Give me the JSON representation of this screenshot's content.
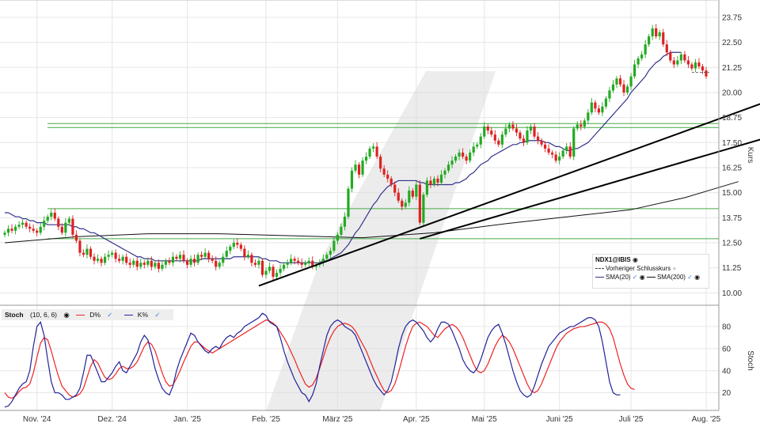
{
  "chart_data": [
    {
      "type": "candlestick",
      "symbol": "NDX1@IBIS",
      "ylabel": "Kurs",
      "ylim": [
        9.5,
        24.3
      ],
      "y_ticks": [
        "10.00",
        "11.25",
        "12.50",
        "13.75",
        "15.00",
        "16.25",
        "17.50",
        "18.75",
        "20.00",
        "21.25",
        "22.50",
        "23.75"
      ],
      "x_ticks": [
        "Nov. '24",
        "Dez. '24",
        "Jan. '25",
        "Feb. '25",
        "März '25",
        "Apr. '25",
        "Mai '25",
        "Juni '25",
        "Juli '25",
        "Aug. '25"
      ],
      "x_tick_pos": [
        9,
        30,
        51,
        73,
        93,
        115,
        134,
        155,
        175,
        196
      ],
      "close": [
        13.0,
        13.2,
        13.1,
        13.3,
        13.4,
        13.5,
        13.3,
        13.2,
        13.1,
        13.0,
        13.3,
        13.6,
        13.8,
        14.0,
        13.7,
        13.3,
        13.0,
        13.5,
        13.7,
        12.9,
        12.6,
        12.0,
        11.9,
        12.2,
        11.8,
        11.6,
        11.7,
        11.5,
        11.8,
        11.9,
        12.0,
        11.7,
        11.6,
        11.8,
        11.5,
        11.4,
        11.6,
        11.3,
        11.5,
        11.4,
        11.6,
        11.3,
        11.5,
        11.2,
        11.4,
        11.6,
        11.5,
        11.8,
        11.7,
        11.9,
        11.6,
        11.4,
        11.7,
        11.5,
        11.9,
        11.8,
        12.0,
        11.7,
        11.6,
        11.3,
        11.5,
        11.8,
        12.1,
        12.3,
        12.5,
        12.4,
        12.2,
        11.8,
        11.9,
        11.5,
        11.4,
        11.6,
        10.9,
        11.1,
        11.3,
        10.8,
        11.0,
        11.2,
        11.4,
        11.5,
        11.7,
        11.6,
        11.5,
        11.4,
        11.5,
        11.6,
        11.3,
        11.4,
        11.5,
        11.7,
        11.9,
        12.1,
        12.6,
        12.9,
        13.3,
        13.8,
        15.2,
        16.1,
        16.4,
        15.9,
        16.6,
        16.8,
        17.2,
        17.3,
        16.8,
        16.2,
        15.9,
        15.7,
        15.4,
        15.0,
        14.6,
        14.3,
        14.5,
        15.1,
        14.8,
        15.4,
        13.5,
        14.9,
        15.6,
        15.4,
        15.7,
        15.5,
        15.9,
        16.1,
        16.4,
        16.6,
        16.8,
        17.0,
        16.8,
        16.6,
        17.0,
        17.3,
        17.4,
        17.8,
        18.3,
        18.1,
        17.9,
        17.6,
        17.4,
        17.9,
        18.2,
        18.4,
        18.2,
        18.0,
        17.7,
        17.5,
        18.1,
        18.3,
        17.8,
        17.6,
        17.4,
        17.2,
        17.0,
        16.9,
        16.6,
        16.8,
        17.1,
        17.3,
        16.8,
        18.2,
        18.4,
        18.3,
        18.6,
        19.0,
        19.5,
        19.2,
        19.0,
        19.3,
        19.7,
        20.1,
        20.4,
        20.7,
        20.4,
        20.0,
        20.3,
        20.8,
        21.4,
        21.7,
        21.9,
        22.4,
        22.8,
        23.2,
        22.8,
        23.0,
        22.4,
        22.0,
        21.6,
        21.4,
        21.6,
        21.9,
        21.6,
        21.4,
        21.2,
        21.5,
        21.3,
        21.1,
        20.8
      ],
      "sma20": [
        14.0,
        14.0,
        13.9,
        13.8,
        13.8,
        13.7,
        13.7,
        13.6,
        13.6,
        13.5,
        13.5,
        13.5,
        13.4,
        13.4,
        13.4,
        13.4,
        13.4,
        13.4,
        13.4,
        13.3,
        13.3,
        13.2,
        13.2,
        13.1,
        13.0,
        13.0,
        12.9,
        12.8,
        12.7,
        12.6,
        12.5,
        12.4,
        12.3,
        12.2,
        12.1,
        12.0,
        11.9,
        11.8,
        11.8,
        11.7,
        11.7,
        11.7,
        11.6,
        11.6,
        11.6,
        11.6,
        11.6,
        11.6,
        11.6,
        11.6,
        11.6,
        11.6,
        11.6,
        11.6,
        11.6,
        11.7,
        11.7,
        11.7,
        11.7,
        11.7,
        11.7,
        11.7,
        11.7,
        11.7,
        11.8,
        11.8,
        11.8,
        11.8,
        11.8,
        11.8,
        11.8,
        11.8,
        11.7,
        11.7,
        11.6,
        11.6,
        11.6,
        11.5,
        11.5,
        11.5,
        11.5,
        11.5,
        11.5,
        11.5,
        11.5,
        11.5,
        11.5,
        11.5,
        11.5,
        11.6,
        11.6,
        11.7,
        11.8,
        11.9,
        12.0,
        12.2,
        12.4,
        12.7,
        13.0,
        13.2,
        13.5,
        13.8,
        14.1,
        14.4,
        14.6,
        14.9,
        15.1,
        15.3,
        15.4,
        15.5,
        15.6,
        15.6,
        15.6,
        15.6,
        15.6,
        15.6,
        15.5,
        15.5,
        15.4,
        15.4,
        15.4,
        15.4,
        15.4,
        15.4,
        15.4,
        15.4,
        15.5,
        15.5,
        15.6,
        15.7,
        15.9,
        16.0,
        16.2,
        16.4,
        16.5,
        16.6,
        16.8,
        16.9,
        17.0,
        17.1,
        17.2,
        17.3,
        17.4,
        17.4,
        17.5,
        17.5,
        17.6,
        17.6,
        17.6,
        17.6,
        17.6,
        17.5,
        17.5,
        17.4,
        17.3,
        17.3,
        17.2,
        17.1,
        17.1,
        17.2,
        17.2,
        17.3,
        17.4,
        17.5,
        17.7,
        17.9,
        18.1,
        18.3,
        18.5,
        18.7,
        18.9,
        19.1,
        19.3,
        19.5,
        19.7,
        20.0,
        20.2,
        20.4,
        20.6,
        20.8,
        21.1,
        21.3,
        21.5,
        21.6,
        21.8,
        21.9,
        22.0,
        22.0,
        22.0,
        22.0
      ],
      "sma200": [
        {
          "x": 0,
          "y": 12.5
        },
        {
          "x": 20,
          "y": 12.8
        },
        {
          "x": 40,
          "y": 12.95
        },
        {
          "x": 60,
          "y": 12.95
        },
        {
          "x": 80,
          "y": 12.85
        },
        {
          "x": 100,
          "y": 12.75
        },
        {
          "x": 120,
          "y": 13.0
        },
        {
          "x": 140,
          "y": 13.45
        },
        {
          "x": 160,
          "y": 13.85
        },
        {
          "x": 175,
          "y": 14.15
        },
        {
          "x": 190,
          "y": 14.75
        },
        {
          "x": 205,
          "y": 15.55
        }
      ],
      "prev_close": 21.0,
      "hlines": [
        14.2,
        12.7,
        18.45,
        18.25
      ],
      "trendlines": [
        [
          {
            "x": 71,
            "y": 10.35
          },
          {
            "x": 213,
            "y": 19.55
          }
        ],
        [
          {
            "x": 116,
            "y": 12.7
          },
          {
            "x": 213,
            "y": 17.75
          }
        ]
      ],
      "legend": {
        "title": "NDX1@IBIS",
        "prev": "Vorheriger Schlusskurs",
        "sma20": "SMA(20)",
        "sma200": "SMA(200)"
      },
      "colors": {
        "up": "#22aa22",
        "down": "#dd2222",
        "sma20": "#33338c",
        "sma200": "#111111",
        "hline": "#44aa44",
        "trend": "#000000",
        "watermark": "#dddddd"
      }
    },
    {
      "type": "line",
      "title": "Stoch",
      "params": "(10, 6, 6)",
      "ylabel": "Stoch",
      "ylim": [
        4,
        95
      ],
      "y_ticks": [
        "20",
        "40",
        "60",
        "80"
      ],
      "series": [
        {
          "name": "D%",
          "color": "#ee2222",
          "values": [
            20,
            16,
            15,
            17,
            21,
            24,
            25,
            28,
            38,
            52,
            65,
            70,
            68,
            58,
            46,
            35,
            26,
            22,
            18,
            16,
            17,
            19,
            24,
            34,
            44,
            50,
            47,
            40,
            34,
            32,
            33,
            37,
            42,
            44,
            42,
            42,
            44,
            48,
            55,
            62,
            66,
            64,
            58,
            48,
            38,
            30,
            26,
            27,
            33,
            40,
            48,
            55,
            62,
            66,
            66,
            63,
            60,
            58,
            56,
            58,
            60,
            62,
            64,
            66,
            68,
            70,
            72,
            74,
            76,
            78,
            80,
            82,
            84,
            86,
            85,
            83,
            80,
            75,
            70,
            64,
            57,
            50,
            42,
            35,
            28,
            25,
            27,
            33,
            42,
            52,
            62,
            70,
            76,
            80,
            82,
            83,
            82,
            80,
            76,
            70,
            64,
            58,
            50,
            42,
            35,
            28,
            22,
            20,
            22,
            28,
            38,
            50,
            62,
            72,
            80,
            83,
            84,
            82,
            80,
            76,
            72,
            70,
            74,
            78,
            80,
            82,
            80,
            76,
            70,
            62,
            54,
            46,
            40,
            38,
            40,
            46,
            54,
            62,
            68,
            72,
            70,
            66,
            60,
            52,
            44,
            36,
            28,
            22,
            20,
            22,
            28,
            36,
            44,
            52,
            60,
            66,
            70,
            74,
            76,
            78,
            79,
            80,
            80,
            81,
            82,
            83,
            84,
            84,
            82,
            78,
            70,
            58,
            46,
            36,
            28,
            24,
            23
          ]
        },
        {
          "name": "K%",
          "color": "#22229a",
          "values": [
            7,
            8,
            12,
            18,
            24,
            28,
            30,
            40,
            62,
            80,
            84,
            72,
            50,
            30,
            20,
            20,
            18,
            14,
            14,
            16,
            18,
            24,
            38,
            54,
            54,
            46,
            38,
            30,
            30,
            34,
            38,
            44,
            48,
            40,
            38,
            44,
            50,
            56,
            66,
            72,
            68,
            56,
            42,
            32,
            24,
            20,
            18,
            26,
            40,
            50,
            58,
            66,
            74,
            72,
            66,
            62,
            58,
            56,
            60,
            62,
            60,
            66,
            70,
            72,
            70,
            74,
            76,
            80,
            82,
            84,
            86,
            88,
            92,
            90,
            84,
            82,
            80,
            70,
            58,
            48,
            40,
            32,
            26,
            20,
            18,
            12,
            18,
            28,
            44,
            58,
            72,
            80,
            84,
            86,
            84,
            80,
            78,
            76,
            72,
            64,
            56,
            48,
            40,
            32,
            26,
            22,
            18,
            22,
            30,
            44,
            60,
            72,
            80,
            84,
            86,
            84,
            80,
            76,
            70,
            66,
            70,
            78,
            84,
            84,
            82,
            76,
            68,
            60,
            50,
            44,
            40,
            38,
            42,
            50,
            60,
            70,
            76,
            80,
            82,
            74,
            64,
            52,
            40,
            30,
            22,
            18,
            16,
            18,
            26,
            36,
            46,
            54,
            62,
            66,
            70,
            74,
            76,
            78,
            80,
            80,
            82,
            84,
            86,
            88,
            88,
            86,
            80,
            66,
            48,
            30,
            20,
            18,
            18
          ]
        }
      ]
    }
  ]
}
